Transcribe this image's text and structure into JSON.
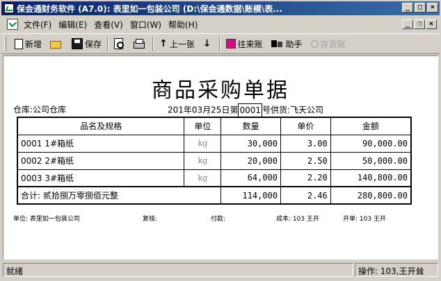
{
  "window": {
    "title": "保会通财务软件 (A7.0): 表里如一包装公司 (D:\\保会通数据\\账模\\表...",
    "min": "_",
    "max": "□",
    "close": "×"
  },
  "menu": {
    "items": [
      "文件(F)",
      "编辑(E)",
      "查看(V)",
      "窗口(W)",
      "帮助(H)"
    ],
    "mdi_min": "_",
    "mdi_restore": "❐",
    "mdi_close": "×"
  },
  "toolbar": {
    "new": "新增",
    "save": "保存",
    "prev": "上一张",
    "contacts": "往来账",
    "helper": "助手",
    "stock": "存货账"
  },
  "document": {
    "title": "商品采购单据",
    "warehouse": "仓库:公司仓库",
    "year_prefix": "201",
    "date_rest": "年03月25日第",
    "bill_no": "0001",
    "no_suffix": "号",
    "supplier": "供货:飞天公司",
    "columns": [
      "品名及规格",
      "单位",
      "数量",
      "单价",
      "金额"
    ],
    "rows": [
      {
        "name": "0001 1#箱纸",
        "unit": "kg",
        "qty": "30,000",
        "price": "3.00",
        "amount": "90,000.00"
      },
      {
        "name": "0002 2#箱纸",
        "unit": "kg",
        "qty": "20,000",
        "price": "2.50",
        "amount": "50,000.00"
      },
      {
        "name": "0003 3#箱纸",
        "unit": "kg",
        "qty": "64,000",
        "price": "2.20",
        "amount": "140,800.00"
      }
    ],
    "total": {
      "label": "合计: 贰拾捌万零捌佰元整",
      "qty": "114,000",
      "price": "2.46",
      "amount": "280,800.00"
    },
    "footer": {
      "company": "单位: 表里如一包装公司",
      "review": "复核:",
      "payment": "付款:",
      "cost": "成本: 103 王开",
      "maker": "开单: 103 王开"
    }
  },
  "status": {
    "left": "就绪",
    "right": "操作: 103,王开耸"
  }
}
